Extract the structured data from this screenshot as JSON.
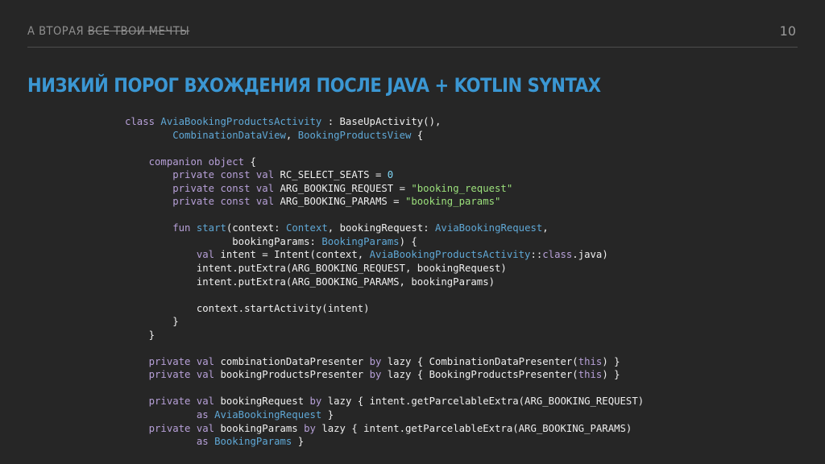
{
  "header": {
    "section_prefix": "А ВТОРАЯ ",
    "section_strike": "ВСЕ ТВОИ МЕЧТЫ",
    "page_number": "10"
  },
  "title": "НИЗКИЙ ПОРОГ ВХОЖДЕНИЯ ПОСЛЕ JAVA + KOTLIN SYNTAX",
  "colors": {
    "background": "#262626",
    "title": "#3b97d3",
    "keyword": "#b7a0d8",
    "type": "#5fa8d6",
    "string": "#9be07b",
    "number": "#7fd6f5",
    "plain": "#efefef"
  },
  "code_lines": [
    [
      [
        "kw",
        "class "
      ],
      [
        "type",
        "AviaBookingProductsActivity"
      ],
      [
        "plain",
        " : BaseUpActivity(),"
      ]
    ],
    [
      [
        "plain",
        "        "
      ],
      [
        "type",
        "CombinationDataView"
      ],
      [
        "plain",
        ", "
      ],
      [
        "type",
        "BookingProductsView"
      ],
      [
        "plain",
        " {"
      ]
    ],
    [],
    [
      [
        "plain",
        "    "
      ],
      [
        "kw",
        "companion object"
      ],
      [
        "plain",
        " {"
      ]
    ],
    [
      [
        "plain",
        "        "
      ],
      [
        "kw",
        "private const val"
      ],
      [
        "plain",
        " RC_SELECT_SEATS = "
      ],
      [
        "num",
        "0"
      ]
    ],
    [
      [
        "plain",
        "        "
      ],
      [
        "kw",
        "private const val"
      ],
      [
        "plain",
        " ARG_BOOKING_REQUEST = "
      ],
      [
        "str",
        "\"booking_request\""
      ]
    ],
    [
      [
        "plain",
        "        "
      ],
      [
        "kw",
        "private const val"
      ],
      [
        "plain",
        " ARG_BOOKING_PARAMS = "
      ],
      [
        "str",
        "\"booking_params\""
      ]
    ],
    [],
    [
      [
        "plain",
        "        "
      ],
      [
        "kw",
        "fun"
      ],
      [
        "plain",
        " "
      ],
      [
        "type",
        "start"
      ],
      [
        "plain",
        "(context: "
      ],
      [
        "type",
        "Context"
      ],
      [
        "plain",
        ", bookingRequest: "
      ],
      [
        "type",
        "AviaBookingRequest"
      ],
      [
        "plain",
        ","
      ]
    ],
    [
      [
        "plain",
        "                  bookingParams: "
      ],
      [
        "type",
        "BookingParams"
      ],
      [
        "plain",
        ") {"
      ]
    ],
    [
      [
        "plain",
        "            "
      ],
      [
        "kw",
        "val"
      ],
      [
        "plain",
        " intent = Intent(context, "
      ],
      [
        "type",
        "AviaBookingProductsActivity"
      ],
      [
        "plain",
        "::"
      ],
      [
        "kw",
        "class"
      ],
      [
        "plain",
        ".java)"
      ]
    ],
    [
      [
        "plain",
        "            intent.putExtra(ARG_BOOKING_REQUEST, bookingRequest)"
      ]
    ],
    [
      [
        "plain",
        "            intent.putExtra(ARG_BOOKING_PARAMS, bookingParams)"
      ]
    ],
    [],
    [
      [
        "plain",
        "            context.startActivity(intent)"
      ]
    ],
    [
      [
        "plain",
        "        }"
      ]
    ],
    [
      [
        "plain",
        "    }"
      ]
    ],
    [],
    [
      [
        "plain",
        "    "
      ],
      [
        "kw",
        "private val"
      ],
      [
        "plain",
        " combinationDataPresenter "
      ],
      [
        "kw",
        "by"
      ],
      [
        "plain",
        " lazy { CombinationDataPresenter("
      ],
      [
        "kw",
        "this"
      ],
      [
        "plain",
        ") }"
      ]
    ],
    [
      [
        "plain",
        "    "
      ],
      [
        "kw",
        "private val"
      ],
      [
        "plain",
        " bookingProductsPresenter "
      ],
      [
        "kw",
        "by"
      ],
      [
        "plain",
        " lazy { BookingProductsPresenter("
      ],
      [
        "kw",
        "this"
      ],
      [
        "plain",
        ") }"
      ]
    ],
    [],
    [
      [
        "plain",
        "    "
      ],
      [
        "kw",
        "private val"
      ],
      [
        "plain",
        " bookingRequest "
      ],
      [
        "kw",
        "by"
      ],
      [
        "plain",
        " lazy { intent.getParcelableExtra(ARG_BOOKING_REQUEST)"
      ]
    ],
    [
      [
        "plain",
        "            "
      ],
      [
        "kw",
        "as"
      ],
      [
        "plain",
        " "
      ],
      [
        "type",
        "AviaBookingRequest"
      ],
      [
        "plain",
        " }"
      ]
    ],
    [
      [
        "plain",
        "    "
      ],
      [
        "kw",
        "private val"
      ],
      [
        "plain",
        " bookingParams "
      ],
      [
        "kw",
        "by"
      ],
      [
        "plain",
        " lazy { intent.getParcelableExtra(ARG_BOOKING_PARAMS)"
      ]
    ],
    [
      [
        "plain",
        "            "
      ],
      [
        "kw",
        "as"
      ],
      [
        "plain",
        " "
      ],
      [
        "type",
        "BookingParams"
      ],
      [
        "plain",
        " }"
      ]
    ]
  ]
}
